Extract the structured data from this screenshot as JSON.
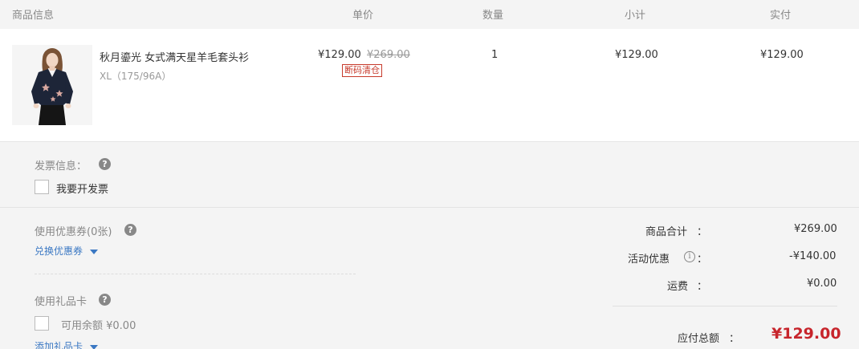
{
  "columns": {
    "product": "商品信息",
    "unit_price": "单价",
    "quantity": "数量",
    "subtotal": "小计",
    "actual": "实付"
  },
  "product": {
    "name": "秋月鎏光 女式满天星羊毛套头衫",
    "spec": "XL（175/96A）",
    "price": "¥129.00",
    "original_price": "¥269.00",
    "badge": "断码清仓",
    "quantity": "1",
    "subtotal": "¥129.00",
    "actual": "¥129.00",
    "image_icon": "sweater-product-photo"
  },
  "invoice": {
    "label": "发票信息：",
    "help": "?",
    "checkbox_label": "我要开发票"
  },
  "coupon": {
    "label": "使用优惠券(0张)",
    "help": "?",
    "link": "兑换优惠券"
  },
  "gift_card": {
    "label": "使用礼品卡",
    "help": "?",
    "balance_label": "可用余额 ¥0.00",
    "link": "添加礼品卡"
  },
  "summary": {
    "goods_total_label": "商品合计",
    "goods_total_value": "¥269.00",
    "discount_label": "活动优惠",
    "discount_info": "i",
    "discount_value": "-¥140.00",
    "shipping_label": "运费",
    "shipping_value": "¥0.00",
    "colon": "：",
    "total_label": "应付总额",
    "total_value": "¥129.00"
  },
  "colors": {
    "accent_red": "#c7252c",
    "link_blue": "#3b78c3",
    "badge_red": "#c73a2b"
  }
}
